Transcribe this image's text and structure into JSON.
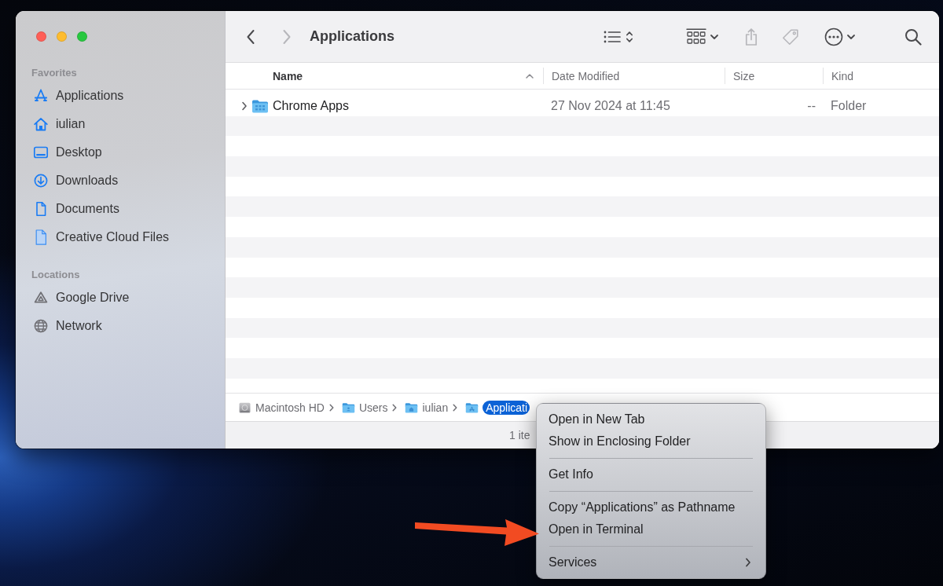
{
  "window": {
    "controls": [
      {
        "kind": "close"
      },
      {
        "kind": "minimize"
      },
      {
        "kind": "zoom"
      }
    ]
  },
  "sidebar": {
    "sections": [
      {
        "heading": "Favorites",
        "items": [
          {
            "label": "Applications",
            "kind": "apps",
            "selected": false
          },
          {
            "label": "iulian",
            "kind": "home",
            "selected": false
          },
          {
            "label": "Desktop",
            "kind": "desktop",
            "selected": false
          },
          {
            "label": "Downloads",
            "kind": "downloads",
            "selected": false
          },
          {
            "label": "Documents",
            "kind": "document",
            "selected": false
          },
          {
            "label": "Creative Cloud Files",
            "kind": "file",
            "selected": false
          }
        ]
      },
      {
        "heading": "Locations",
        "items": [
          {
            "label": "Google Drive",
            "kind": "drive",
            "selected": false
          },
          {
            "label": "Network",
            "kind": "network",
            "selected": false
          }
        ]
      }
    ]
  },
  "toolbar": {
    "navigation": [
      {
        "kind": "back",
        "disabled": false
      },
      {
        "kind": "forward",
        "disabled": true
      }
    ],
    "title": "Applications",
    "buttons": [
      {
        "kind": "view",
        "disabled": false
      },
      {
        "kind": "group",
        "disabled": false
      },
      {
        "kind": "share",
        "disabled": true
      },
      {
        "kind": "tag",
        "disabled": true
      },
      {
        "kind": "more",
        "disabled": false
      },
      {
        "kind": "search",
        "disabled": false
      }
    ]
  },
  "table": {
    "columns": [
      {
        "label": "Name",
        "sorted": true
      },
      {
        "label": "Date Modified",
        "sorted": false
      },
      {
        "label": "Size",
        "sorted": false
      },
      {
        "label": "Kind",
        "sorted": false
      }
    ],
    "rows": [
      {
        "cells": [
          "Chrome Apps",
          "27 Nov 2024 at 11:45",
          "--",
          "Folder"
        ],
        "kind": "folder",
        "expanded": false,
        "selected": false
      }
    ]
  },
  "path_bar": {
    "items": [
      {
        "label": "Macintosh HD",
        "kind": "disk",
        "selected": false
      },
      {
        "label": "Users",
        "kind": "users",
        "selected": false
      },
      {
        "label": "iulian",
        "kind": "home",
        "selected": false
      },
      {
        "label": "Applicati",
        "kind": "apps",
        "selected": true
      }
    ]
  },
  "status_bar": {
    "text": "1 ite"
  },
  "context_menu": {
    "items": [
      {
        "kind": "item",
        "label": "Open in New Tab"
      },
      {
        "kind": "item",
        "label": "Show in Enclosing Folder"
      },
      {
        "kind": "separator"
      },
      {
        "kind": "item",
        "label": "Get Info"
      },
      {
        "kind": "separator"
      },
      {
        "kind": "item",
        "label": "Copy “Applications” as Pathname"
      },
      {
        "kind": "item",
        "label": "Open in Terminal"
      },
      {
        "kind": "separator"
      },
      {
        "kind": "submenu",
        "label": "Services"
      }
    ]
  }
}
